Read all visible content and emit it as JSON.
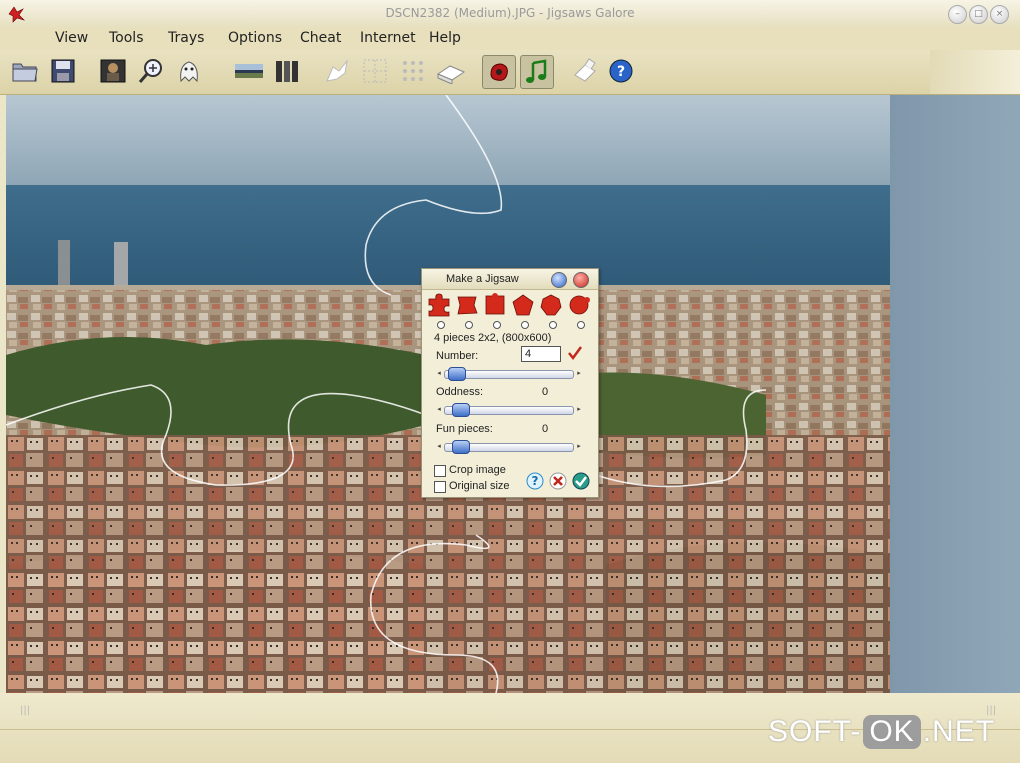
{
  "window": {
    "title": "DSCN2382 (Medium).JPG - Jigsaws Galore"
  },
  "menu": [
    "View",
    "Tools",
    "Trays",
    "Options",
    "Cheat",
    "Internet",
    "Help"
  ],
  "toolbar": {
    "icons": [
      "open-folder-icon",
      "save-disk-icon",
      "picture-icon",
      "zoom-icon",
      "ghost-icon",
      "image-strip-icon",
      "books-icon",
      "piece-icon",
      "grid-dotted-icon",
      "grid-icon",
      "tray-icon",
      "sound-fx-icon",
      "music-note-icon",
      "piece-box-icon",
      "help-icon"
    ]
  },
  "dialog": {
    "title": "Make a Jigsaw",
    "summary": "4 pieces 2x2, (800x600)",
    "number_label": "Number:",
    "number_value": "4",
    "oddness_label": "Oddness:",
    "oddness_value": "0",
    "fun_label": "Fun pieces:",
    "fun_value": "0",
    "crop_label": "Crop image",
    "original_label": "Original size",
    "piece_color": "#d42a1c",
    "slider_levels": {
      "number": 0.0,
      "oddness": 0.0,
      "fun": 0.0
    }
  },
  "watermark": {
    "left": "SOFT-",
    "mid": "OK",
    "right": ".NET"
  }
}
